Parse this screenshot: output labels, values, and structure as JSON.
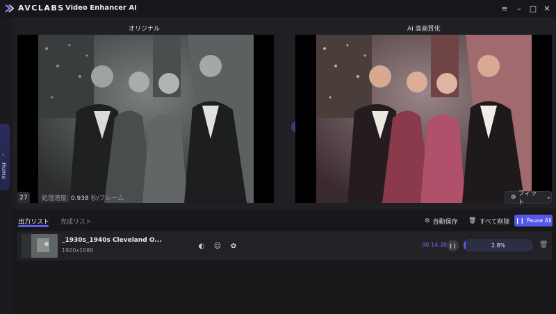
{
  "app": {
    "logo_text": "AVCLABS",
    "name": "Video Enhancer AI",
    "window_controls": [
      "menu-icon",
      "minimize-icon",
      "maximize-icon",
      "close-icon"
    ]
  },
  "sidebar": {
    "home_label": "Home"
  },
  "preview": {
    "original_label": "オリジナル",
    "enhanced_label": "AI 高画質化",
    "frame_number": "27",
    "speed_label": "処理速度:",
    "speed_value": "0.938",
    "speed_unit": "秒/フレーム",
    "fit_label": "フィット"
  },
  "output": {
    "tab_output": "出力リスト",
    "tab_done": "完成リスト",
    "auto_save_label": "自動保存",
    "delete_all_label": "すべて削除",
    "pause_all_label": "Pause All",
    "items": [
      {
        "filename": "_1930s_1940s Cleveland O...",
        "resolution": "1920x1080",
        "time": "00:14:38",
        "progress_text": "2.8%",
        "progress": 0.028
      }
    ]
  },
  "colors": {
    "accent": "#5b5ef0",
    "time": "#6e74ff"
  }
}
